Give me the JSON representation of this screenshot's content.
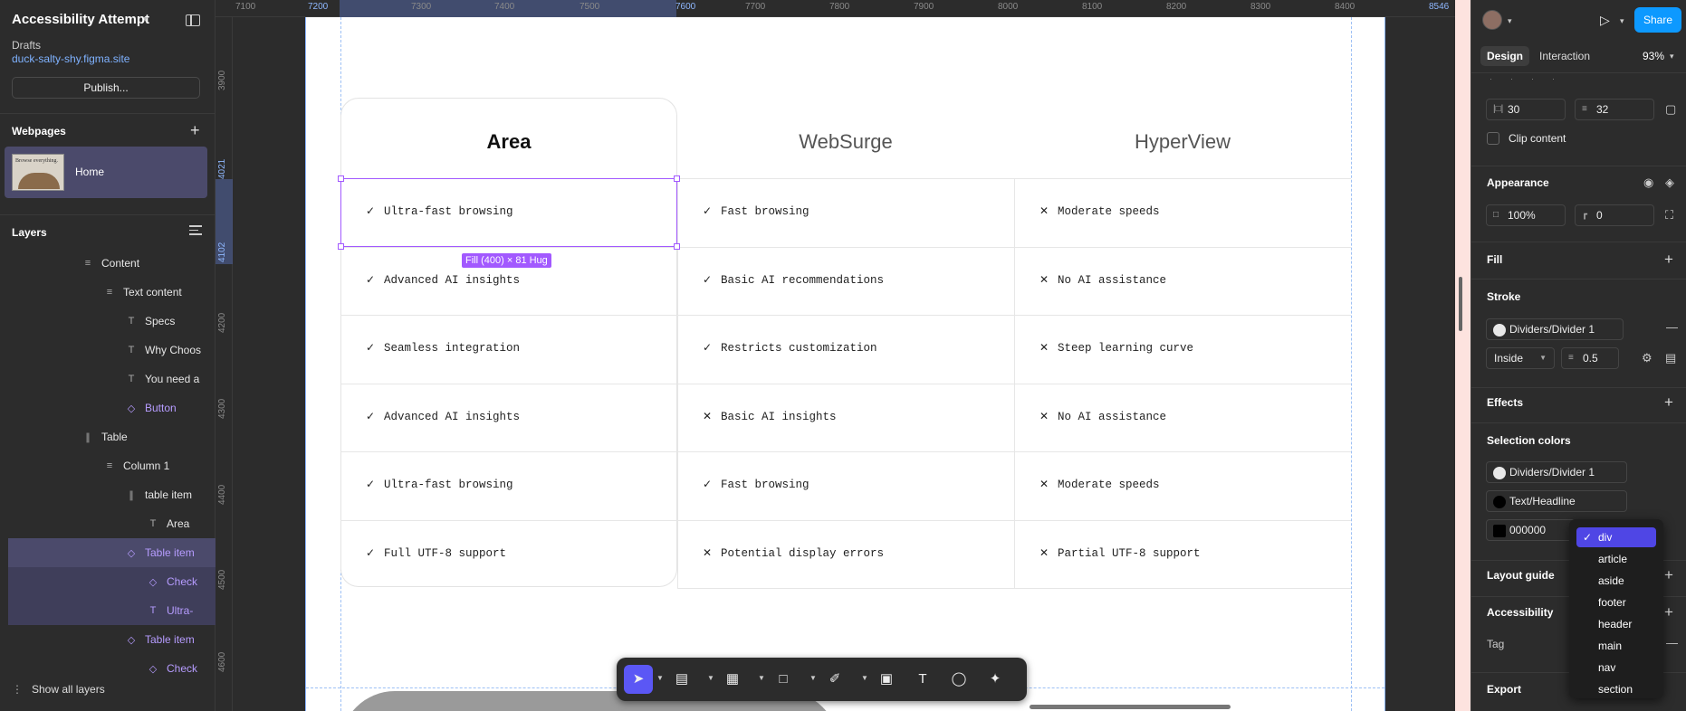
{
  "project": {
    "title": "Accessibility Attempt",
    "location": "Drafts",
    "site": "duck-salty-shy.figma.site",
    "publish_label": "Publish..."
  },
  "webpages": {
    "title": "Webpages",
    "pages": [
      {
        "name": "Home",
        "thumb_text": "Browse everything."
      }
    ]
  },
  "layers": {
    "title": "Layers",
    "items": [
      {
        "label": "Content",
        "icon": "≡"
      },
      {
        "label": "Text content",
        "icon": "≡"
      },
      {
        "label": "Specs",
        "icon": "T"
      },
      {
        "label": "Why Choos",
        "icon": "T"
      },
      {
        "label": "You need a",
        "icon": "T"
      },
      {
        "label": "Button",
        "icon": "◇"
      },
      {
        "label": "Table",
        "icon": "∥"
      },
      {
        "label": "Column 1",
        "icon": "≡"
      },
      {
        "label": "table item",
        "icon": "∥"
      },
      {
        "label": "Area",
        "icon": "T"
      },
      {
        "label": "Table item",
        "icon": "◇"
      },
      {
        "label": "Check",
        "icon": "◇"
      },
      {
        "label": "Ultra-",
        "icon": "T"
      },
      {
        "label": "Table item",
        "icon": "◇"
      },
      {
        "label": "Check",
        "icon": "◇"
      }
    ],
    "show_all": "Show all layers"
  },
  "ruler": {
    "x_ticks": [
      "7100",
      "7200",
      "7300",
      "7400",
      "7500",
      "7600",
      "7700",
      "7800",
      "7900",
      "8000",
      "8100",
      "8200",
      "8300",
      "8400",
      "8546"
    ],
    "y_ticks": [
      "3900",
      "4021",
      "4102",
      "4200",
      "4300",
      "4400",
      "4500",
      "4600"
    ]
  },
  "table": {
    "columns": [
      "Area",
      "WebSurge",
      "HyperView"
    ],
    "rows": [
      [
        {
          "mark": "check",
          "text": "Ultra-fast browsing"
        },
        {
          "mark": "check",
          "text": "Fast browsing"
        },
        {
          "mark": "cross",
          "text": "Moderate speeds"
        }
      ],
      [
        {
          "mark": "check",
          "text": "Advanced AI insights"
        },
        {
          "mark": "check",
          "text": "Basic AI recommendations"
        },
        {
          "mark": "cross",
          "text": "No AI assistance"
        }
      ],
      [
        {
          "mark": "check",
          "text": "Seamless integration"
        },
        {
          "mark": "check",
          "text": "Restricts customization"
        },
        {
          "mark": "cross",
          "text": "Steep learning curve"
        }
      ],
      [
        {
          "mark": "check",
          "text": "Advanced AI insights"
        },
        {
          "mark": "cross",
          "text": "Basic AI insights"
        },
        {
          "mark": "cross",
          "text": "No AI assistance"
        }
      ],
      [
        {
          "mark": "check",
          "text": "Ultra-fast browsing"
        },
        {
          "mark": "check",
          "text": "Fast browsing"
        },
        {
          "mark": "cross",
          "text": "Moderate speeds"
        }
      ],
      [
        {
          "mark": "check",
          "text": "Full UTF-8 support"
        },
        {
          "mark": "cross",
          "text": "Potential display errors"
        },
        {
          "mark": "cross",
          "text": "Partial UTF-8 support"
        }
      ]
    ],
    "selection_badge": "Fill (400) × 81 Hug"
  },
  "toolbar": {
    "tools": [
      "move-tool",
      "frame-tool",
      "section-tool",
      "shape-tool",
      "pen-tool",
      "image-tool",
      "text-tool",
      "comment-tool",
      "ai-tool"
    ]
  },
  "design_panel": {
    "share_label": "Share",
    "tabs": [
      "Design",
      "Interaction"
    ],
    "zoom": "93%",
    "gap_h": "30",
    "gap_v": "32",
    "clip_content": "Clip content",
    "appearance": {
      "title": "Appearance",
      "opacity": "100%",
      "radius": "0"
    },
    "fill": {
      "title": "Fill"
    },
    "stroke": {
      "title": "Stroke",
      "style": "Dividers/Divider 1",
      "position": "Inside",
      "weight": "0.5"
    },
    "effects": {
      "title": "Effects"
    },
    "selection_colors": {
      "title": "Selection colors",
      "colors": [
        "Dividers/Divider 1",
        "Text/Headline",
        "000000"
      ]
    },
    "layout_guide": {
      "title": "Layout guide"
    },
    "accessibility": {
      "title": "Accessibility",
      "tag_label": "Tag"
    },
    "export": {
      "title": "Export"
    }
  },
  "tag_dropdown": {
    "selected": "div",
    "options": [
      "div",
      "article",
      "aside",
      "footer",
      "header",
      "main",
      "nav",
      "section"
    ]
  },
  "colors": {
    "accent": "#a259ff",
    "share": "#0d99ff",
    "selected_row": "#4b4a6b",
    "dropdown_selected": "#4f46e5"
  }
}
